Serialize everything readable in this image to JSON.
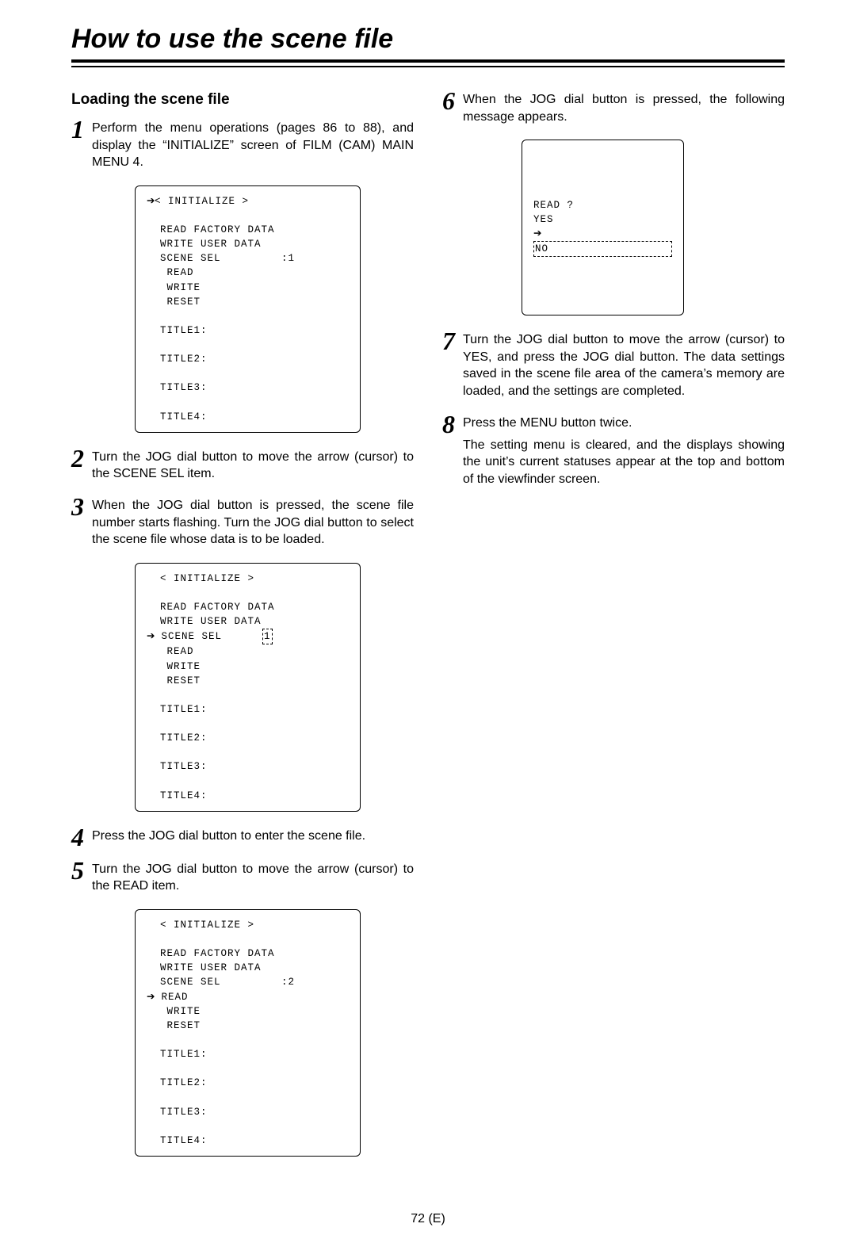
{
  "page_title": "How to use the scene file",
  "section_title": "Loading the scene file",
  "steps": [
    {
      "num": "1",
      "text": "Perform the menu operations (pages 86 to 88), and display the “INITIALIZE” screen of FILM (CAM) MAIN MENU 4."
    },
    {
      "num": "2",
      "text": "Turn the JOG dial button to move the arrow (cursor) to the SCENE SEL item."
    },
    {
      "num": "3",
      "text": "When the JOG dial button is pressed, the scene file number starts flashing.  Turn the JOG dial button to select the scene file whose data is to be loaded."
    },
    {
      "num": "4",
      "text": "Press the JOG dial button to enter the scene file."
    },
    {
      "num": "5",
      "text": "Turn the JOG dial button to move the arrow (cursor) to the READ item."
    },
    {
      "num": "6",
      "text": "When the JOG dial button is pressed, the following message appears."
    },
    {
      "num": "7",
      "text": "Turn the JOG dial button to move the arrow (cursor) to YES, and press the JOG dial button. The data settings saved in the scene file area of the camera’s memory are loaded, and the settings are completed."
    },
    {
      "num": "8",
      "text": "Press the MENU button twice."
    },
    {
      "num": "8b",
      "text": "The setting menu is cleared, and the displays showing the unit’s current statuses appear at the top and bottom of the viewfinder screen."
    }
  ],
  "menus": {
    "m1": {
      "header": "< INITIALIZE >",
      "lines": [
        "READ FACTORY DATA",
        "WRITE USER DATA",
        "SCENE SEL         :1",
        " READ",
        " WRITE",
        " RESET",
        "",
        "TITLE1:",
        "",
        "TITLE2:",
        "",
        "TITLE3:",
        "",
        "TITLE4:"
      ],
      "arrow_row": 0
    },
    "m3": {
      "header": "< INITIALIZE >",
      "lines": [
        "READ FACTORY DATA",
        "WRITE USER DATA",
        "SCENE SEL",
        " READ",
        " WRITE",
        " RESET",
        "",
        "TITLE1:",
        "",
        "TITLE2:",
        "",
        "TITLE3:",
        "",
        "TITLE4:"
      ],
      "arrow_line": 2,
      "blink_value": "1"
    },
    "m5": {
      "header": "< INITIALIZE >",
      "lines": [
        "READ FACTORY DATA",
        "WRITE USER DATA",
        "SCENE SEL         :2",
        " READ",
        " WRITE",
        " RESET",
        "",
        "TITLE1:",
        "",
        "TITLE2:",
        "",
        "TITLE3:",
        "",
        "TITLE4:"
      ],
      "arrow_line": 3
    },
    "m6": {
      "prompt": "READ ?",
      "yes": "YES",
      "no": "NO"
    }
  },
  "footer": "72 (E)"
}
